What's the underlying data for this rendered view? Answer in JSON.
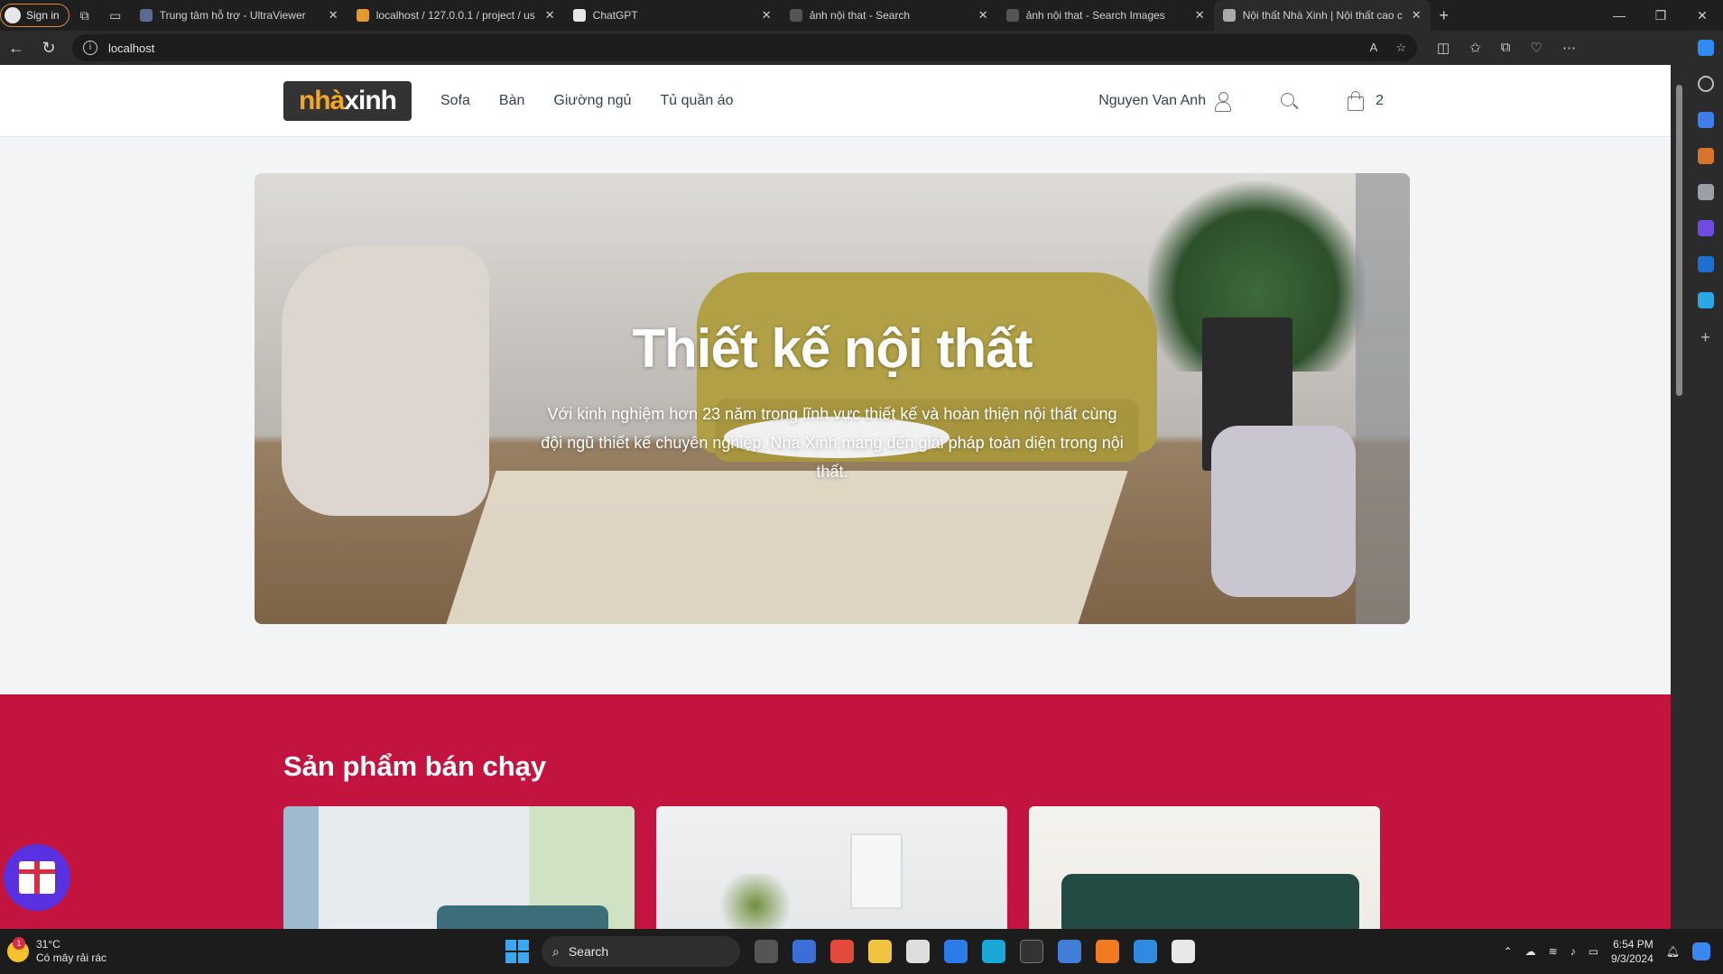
{
  "browser": {
    "signin": "Sign in",
    "tabs": [
      {
        "title": "Trung tâm hỗ trợ - UltraViewer",
        "active": false
      },
      {
        "title": "localhost / 127.0.0.1 / project / us",
        "active": false
      },
      {
        "title": "ChatGPT",
        "active": false
      },
      {
        "title": "ảnh nội that - Search",
        "active": false
      },
      {
        "title": "ảnh nội that - Search Images",
        "active": false
      },
      {
        "title": "Nội thất Nhà Xinh | Nội thất cao c",
        "active": true
      }
    ],
    "address": "localhost"
  },
  "site": {
    "logo_part1": "nhà",
    "logo_part2": "xinh",
    "menu": [
      "Sofa",
      "Bàn",
      "Giường ngủ",
      "Tủ quần áo"
    ],
    "user_name": "Nguyen Van Anh",
    "cart_count": "2",
    "hero": {
      "title": "Thiết kế nội thất",
      "description": "Với kinh nghiệm hơn 23 năm trong lĩnh vực thiết kế và hoàn thiện nội thất cùng đội ngũ thiết kế chuyên nghiệp, Nhà Xinh mang đến giải pháp toàn diện trong nội thất."
    },
    "bestseller_title": "Sản phẩm bán chạy"
  },
  "taskbar": {
    "temperature": "31°C",
    "weather": "Có mây rải rác",
    "weather_badge": "1",
    "search": "Search",
    "time": "6:54 PM",
    "date": "9/3/2024"
  },
  "colors": {
    "accent": "#c2143e",
    "logo_orange": "#f5a623",
    "gift": "#5a31e0"
  }
}
